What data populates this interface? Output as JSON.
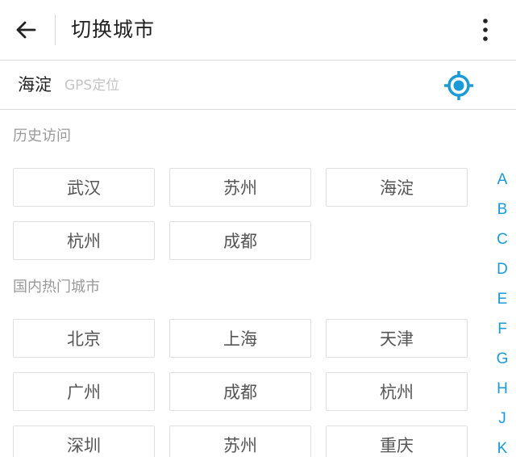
{
  "header": {
    "title": "切换城市",
    "back_icon": "arrow-left-icon",
    "more_icon": "more-vertical-icon"
  },
  "location": {
    "current_city": "海淀",
    "gps_label": "GPS定位",
    "locate_icon": "gps-target-icon",
    "accent_color": "#1b9ad8"
  },
  "history": {
    "title": "历史访问",
    "cities": [
      "武汉",
      "苏州",
      "海淀",
      "杭州",
      "成都"
    ]
  },
  "hot": {
    "title": "国内热门城市",
    "cities": [
      "北京",
      "上海",
      "天津",
      "广州",
      "成都",
      "杭州",
      "深圳",
      "苏州",
      "重庆"
    ]
  },
  "index_letters": [
    "A",
    "B",
    "C",
    "D",
    "E",
    "F",
    "G",
    "H",
    "J",
    "K"
  ]
}
